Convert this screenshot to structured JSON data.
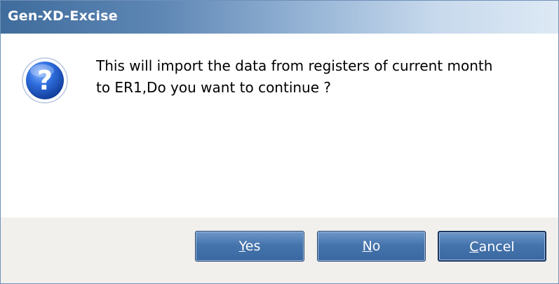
{
  "dialog": {
    "title": "Gen-XD-Excise",
    "message": "This will import the data from registers of current month\nto ER1,Do you want to continue ?",
    "icon": "question-icon"
  },
  "buttons": {
    "yes": {
      "mnemonic": "Y",
      "rest": "es"
    },
    "no": {
      "mnemonic": "N",
      "rest": "o"
    },
    "cancel": {
      "mnemonic": "C",
      "rest": "ancel"
    }
  },
  "colors": {
    "titlebar_start": "#3f6c9c",
    "titlebar_end": "#dde9f5",
    "button": "#4574ac",
    "footer": "#f1f0ec"
  }
}
